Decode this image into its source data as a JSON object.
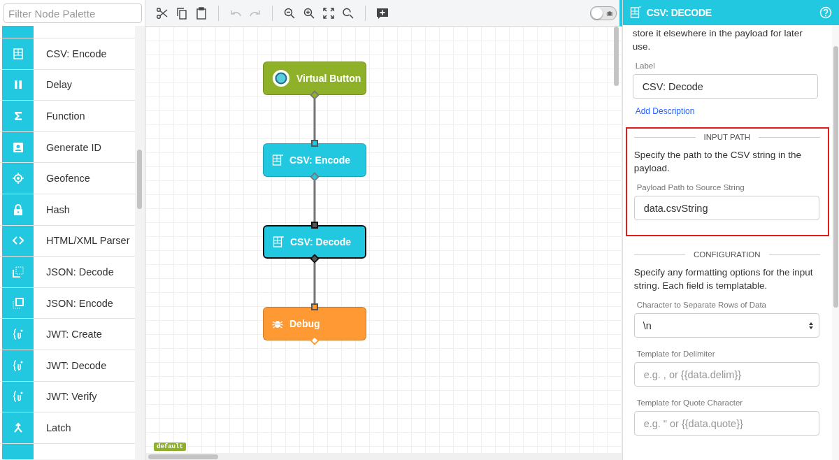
{
  "palette": {
    "filter_placeholder": "Filter Node Palette",
    "items": [
      {
        "label": "CSV: Encode"
      },
      {
        "label": "Delay"
      },
      {
        "label": "Function"
      },
      {
        "label": "Generate ID"
      },
      {
        "label": "Geofence"
      },
      {
        "label": "Hash"
      },
      {
        "label": "HTML/XML Parser"
      },
      {
        "label": "JSON: Decode"
      },
      {
        "label": "JSON: Encode"
      },
      {
        "label": "JWT: Create"
      },
      {
        "label": "JWT: Decode"
      },
      {
        "label": "JWT: Verify"
      },
      {
        "label": "Latch"
      }
    ]
  },
  "toolbar": {
    "tools": [
      {
        "kind": "cut",
        "disabled": false
      },
      {
        "kind": "copy",
        "disabled": false
      },
      {
        "kind": "paste",
        "disabled": false
      },
      {
        "kind": "separator"
      },
      {
        "kind": "undo",
        "disabled": true
      },
      {
        "kind": "redo",
        "disabled": true
      },
      {
        "kind": "separator"
      },
      {
        "kind": "zoomout",
        "disabled": false
      },
      {
        "kind": "zoomin",
        "disabled": false
      },
      {
        "kind": "fit",
        "disabled": false
      },
      {
        "kind": "reset",
        "disabled": false
      },
      {
        "kind": "separator"
      },
      {
        "kind": "comment",
        "disabled": false
      }
    ],
    "debug_toggle": {
      "on": false
    }
  },
  "canvas": {
    "nodes": [
      {
        "kind": "button",
        "label": "Virtual Button",
        "color": "#8fb12a",
        "selected": false
      },
      {
        "kind": "csv",
        "label": "CSV: Encode",
        "color": "#22c7e0",
        "selected": false
      },
      {
        "kind": "csv",
        "label": "CSV: Decode",
        "color": "#22c7e0",
        "selected": true
      },
      {
        "kind": "debug",
        "label": "Debug",
        "color": "#ff9933",
        "selected": false
      }
    ],
    "tag": "default"
  },
  "panel": {
    "title": "CSV: DECODE",
    "description": "store it elsewhere in the payload for later use.",
    "label_field": {
      "label": "Label",
      "value": "CSV: Decode"
    },
    "link": "Add Description",
    "sections": [
      {
        "heading": "INPUT PATH",
        "text": "Specify the path to the CSV string in the payload.",
        "highlighted": true,
        "fields": [
          {
            "kind": "text",
            "label": "Payload Path to Source String",
            "value": "data.csvString"
          }
        ]
      },
      {
        "heading": "CONFIGURATION",
        "text": "Specify any formatting options for the input string. Each field is templatable.",
        "highlighted": false,
        "fields": [
          {
            "kind": "select",
            "label": "Character to Separate Rows of Data",
            "value": "\\n"
          },
          {
            "kind": "text",
            "label": "Template for Delimiter",
            "placeholder": "e.g. , or {{data.delim}}"
          },
          {
            "kind": "text",
            "label": "Template for Quote Character",
            "placeholder": "e.g. \" or {{data.quote}}"
          }
        ]
      }
    ]
  }
}
